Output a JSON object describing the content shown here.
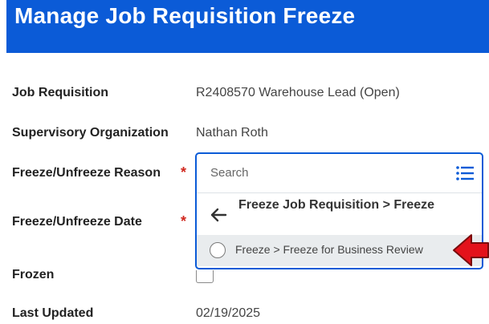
{
  "header": {
    "title": "Manage Job Requisition Freeze",
    "bg_color": "#0b5bd7"
  },
  "fields": {
    "job_requisition": {
      "label": "Job Requisition",
      "value": "R2408570 Warehouse Lead (Open)"
    },
    "supervisory_org": {
      "label": "Supervisory Organization",
      "value": "Nathan Roth"
    },
    "freeze_reason": {
      "label": "Freeze/Unfreeze Reason",
      "required_mark": "*"
    },
    "freeze_date": {
      "label": "Freeze/Unfreeze Date",
      "required_mark": "*"
    },
    "frozen": {
      "label": "Frozen"
    },
    "last_updated": {
      "label": "Last Updated",
      "value": "02/19/2025"
    }
  },
  "dropdown": {
    "search_placeholder": "Search",
    "back_label": "Freeze Job Requisition > Freeze",
    "options": [
      {
        "label": "Freeze > Freeze for Business Review",
        "selected": false
      }
    ]
  },
  "icons": {
    "list": "list-icon",
    "back": "arrow-left-icon",
    "pointer": "red-arrow-pointer-icon"
  },
  "colors": {
    "accent": "#0b5bd7",
    "required": "#d0271d",
    "pointer": "#e3121b"
  }
}
